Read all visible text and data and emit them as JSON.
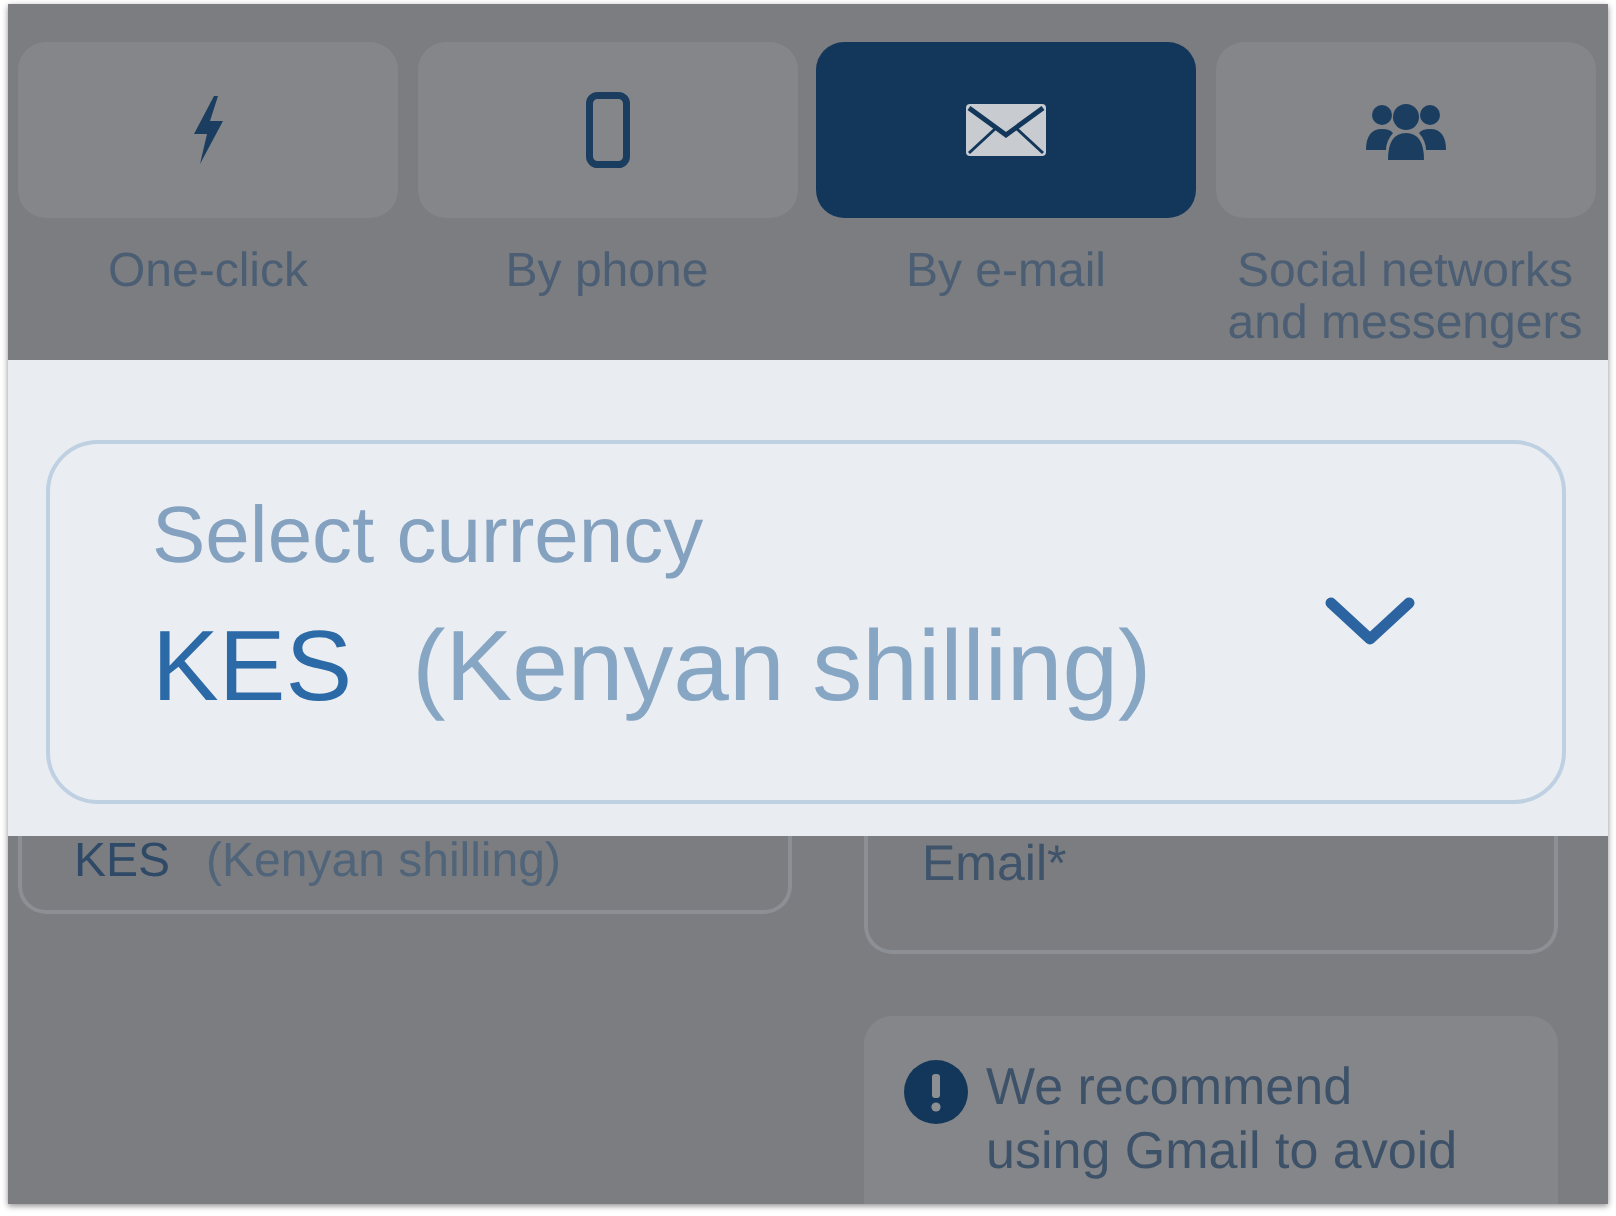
{
  "tabs": [
    {
      "label": "One-click",
      "selected": false
    },
    {
      "label": "By phone",
      "selected": false
    },
    {
      "label": "By e-mail",
      "selected": true
    },
    {
      "label": "Social networks and messengers",
      "selected": false
    }
  ],
  "spotlight": {
    "label": "Select currency",
    "code": "KES",
    "name": "(Kenyan shilling)"
  },
  "form": {
    "currency_field": {
      "code": "KES",
      "name": "(Kenyan shilling)"
    },
    "email_field": {
      "placeholder": "Email*"
    },
    "notice": {
      "text": "We recommend using Gmail to avoid"
    }
  }
}
